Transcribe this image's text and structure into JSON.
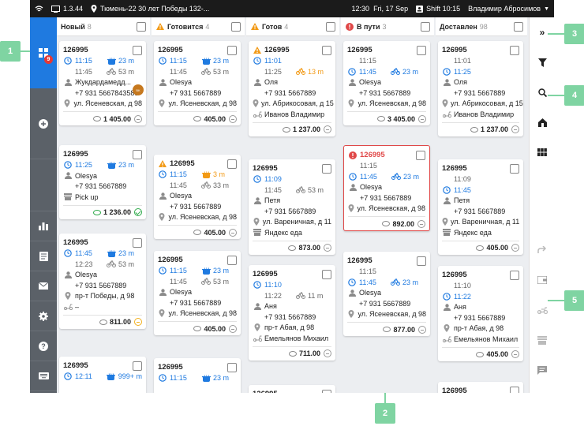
{
  "status": {
    "version": "1.3.44",
    "address": "Тюмень-22 30 лет Победы 132-...",
    "time": "12:30",
    "date": "Fri, 17 Sep",
    "shift": "Shift 10:15",
    "user": "Владимир Абросимов"
  },
  "leftnav": {
    "badge": "9"
  },
  "callouts": [
    "1",
    "2",
    "3",
    "4",
    "5"
  ],
  "columns": [
    {
      "title": "Новый",
      "count": "8",
      "warn": false,
      "alert": false
    },
    {
      "title": "Готовится",
      "count": "4",
      "warn": true,
      "alert": false
    },
    {
      "title": "Готов",
      "count": "4",
      "warn": true,
      "alert": false
    },
    {
      "title": "В пути",
      "count": "3",
      "warn": false,
      "alert": true
    },
    {
      "title": "Доставлен",
      "count": "98",
      "warn": false,
      "alert": false
    }
  ],
  "cards": [
    [
      {
        "id": "126995",
        "t1": "11:15",
        "t1c": "blue",
        "d1": "23 m",
        "d1c": "blue",
        "t2": "11:45",
        "d2": "53 m",
        "name": "Жукдардамедд...",
        "phone": "+7 931 5667843589",
        "addr": "ул. Ясеневская, д 98",
        "total": "1 405.00",
        "state": "minus",
        "logo": true
      },
      {
        "id": "126995",
        "t1": "11:25",
        "t1c": "blue",
        "d1": "23 m",
        "d1c": "blue",
        "name": "Olesya",
        "phone": "+7 931 5667889",
        "addr": "Pick up",
        "addrIcon": "store",
        "total": "1 236.00",
        "state": "ok",
        "green": true
      },
      {
        "id": "126995",
        "t1": "11:45",
        "t1c": "blue",
        "d1": "23 m",
        "d1c": "blue",
        "t2": "12:23",
        "d2": "53 m",
        "name": "Olesya",
        "phone": "+7 931 5667889",
        "addr": "пр-т Победы, д 98",
        "extra": "–",
        "total": "811.00",
        "state": "warn"
      },
      {
        "id": "126995",
        "t1": "12:11",
        "t1c": "blue",
        "d1": "999+ m",
        "d1c": "blue"
      }
    ],
    [
      {
        "id": "126995",
        "t1": "11:15",
        "t1c": "blue",
        "d1": "23 m",
        "d1c": "blue",
        "t2": "11:45",
        "d2": "53 m",
        "name": "Olesya",
        "phone": "+7 931 5667889",
        "addr": "ул. Ясеневская, д 98",
        "total": "405.00",
        "state": "minus"
      },
      {
        "id": "126995",
        "warn": true,
        "t1": "11:15",
        "t1c": "blue",
        "d1": "3 m",
        "d1c": "orange",
        "t2": "11:45",
        "d2": "33 m",
        "name": "Olesya",
        "phone": "+7 931 5667889",
        "addr": "ул. Ясеневская, д 98",
        "total": "405.00",
        "state": "minus"
      },
      {
        "id": "126995",
        "t1": "11:15",
        "t1c": "blue",
        "d1": "23 m",
        "d1c": "blue",
        "t2": "11:45",
        "d2": "53 m",
        "name": "Olesya",
        "phone": "+7 931 5667889",
        "addr": "ул. Ясеневская, д 98",
        "total": "405.00",
        "state": "minus"
      },
      {
        "id": "126995",
        "t1": "11:15",
        "t1c": "blue",
        "d1": "23 m",
        "d1c": "blue"
      }
    ],
    [
      {
        "id": "126995",
        "warn": true,
        "t1": "11:01",
        "t1c": "blue",
        "t2": "11:25",
        "d2": "13 m",
        "d2c": "orange",
        "name": "Оля",
        "phone": "+7 931 5667889",
        "addr": "ул. Абрикосовая, д 15",
        "courier": "Иванов Владимир",
        "total": "1 237.00",
        "state": "minus"
      },
      {
        "id": "126995",
        "t1": "11:09",
        "t1c": "blue",
        "t2": "11:45",
        "d2": "53 m",
        "name": "Петя",
        "phone": "+7 931 5667889",
        "addr": "ул. Вареничная, д 11",
        "courier": "Яндекс еда",
        "courierIcon": "store",
        "total": "873.00",
        "state": "minus"
      },
      {
        "id": "126995",
        "t1": "11:10",
        "t1c": "blue",
        "t2": "11:22",
        "d2": "11 m",
        "name": "Аня",
        "phone": "+7 931 5667889",
        "addr": "пр-т Абая, д 98",
        "courier": "Емельянов Михаил",
        "total": "711.00",
        "state": "minus"
      },
      {
        "id": "126995"
      }
    ],
    [
      {
        "id": "126995",
        "t0": "11:15",
        "t1": "11:45",
        "t1c": "blue",
        "d1": "23 m",
        "d1c": "blue",
        "name": "Olesya",
        "phone": "+7 931 5667889",
        "addr": "ул. Ясеневская, д 98",
        "total": "3 405.00",
        "state": "minus"
      },
      {
        "id": "126995",
        "alert": true,
        "t0": "11:15",
        "t1": "11:45",
        "t1c": "blue",
        "d1": "23 m",
        "d1c": "blue",
        "name": "Olesya",
        "phone": "+7 931 5667889",
        "addr": "ул. Ясеневская, д 98",
        "total": "892.00",
        "state": "minus"
      },
      {
        "id": "126995",
        "t0": "11:15",
        "t1": "11:45",
        "t1c": "blue",
        "d1": "23 m",
        "d1c": "blue",
        "name": "Olesya",
        "phone": "+7 931 5667889",
        "addr": "ул. Ясеневская, д 98",
        "total": "877.00",
        "state": "minus"
      }
    ],
    [
      {
        "id": "126995",
        "t0": "11:01",
        "t1": "11:25",
        "t1c": "blue",
        "name": "Оля",
        "phone": "+7 931 5667889",
        "addr": "ул. Абрикосовая, д 15",
        "courier": "Иванов Владимир",
        "total": "1 237.00",
        "state": "minus"
      },
      {
        "id": "126995",
        "t0": "11:09",
        "t1": "11:45",
        "t1c": "blue",
        "name": "Петя",
        "phone": "+7 931 5667889",
        "addr": "ул. Вареничная, д 11",
        "courier": "Яндекс еда",
        "courierIcon": "store",
        "total": "405.00",
        "state": "minus"
      },
      {
        "id": "126995",
        "t0": "11:10",
        "t1": "11:22",
        "t1c": "blue",
        "name": "Аня",
        "phone": "+7 931 5667889",
        "addr": "пр-т Абая, д 98",
        "courier": "Емельянов Михаил",
        "total": "405.00",
        "state": "minus"
      },
      {
        "id": "126995"
      }
    ]
  ]
}
